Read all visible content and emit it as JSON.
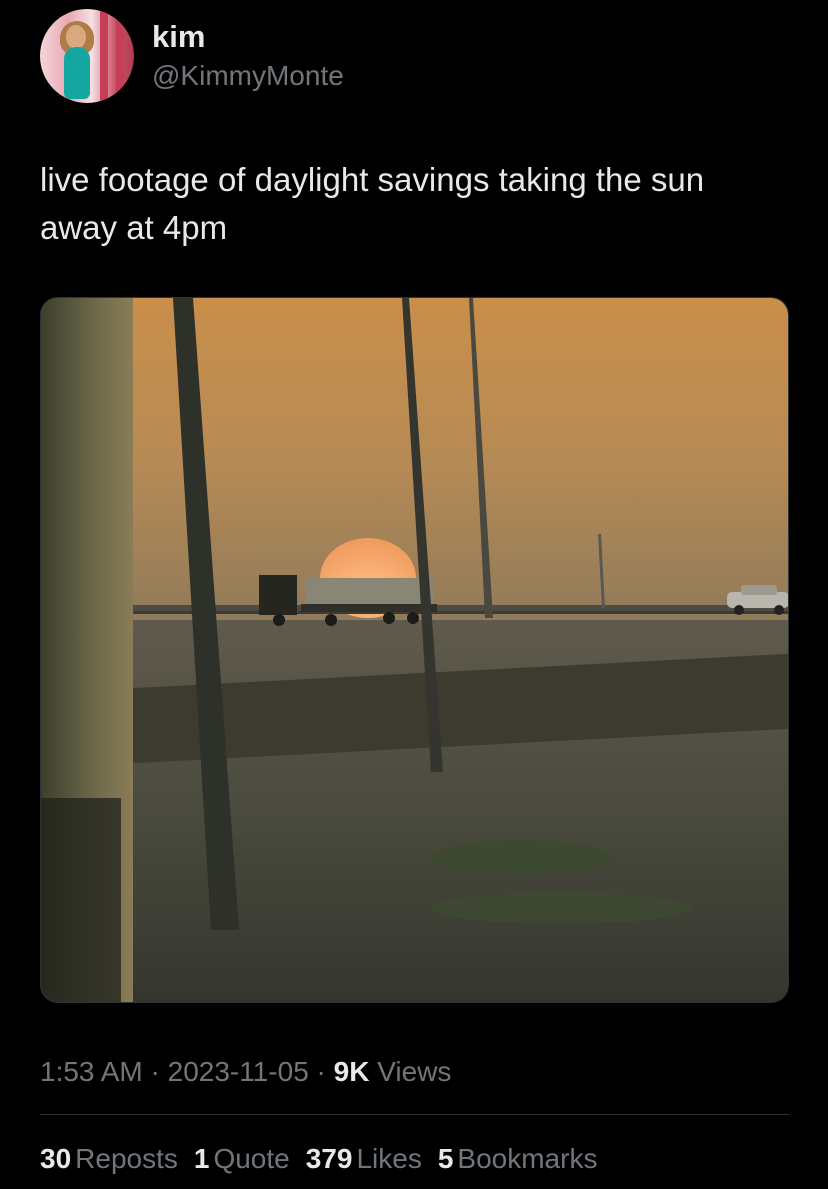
{
  "author": {
    "display_name": "kim",
    "handle": "@KimmyMonte"
  },
  "tweet": {
    "text": "live footage of daylight savings taking the sun away at 4pm",
    "media_description_icon": "photo-sunset-truck"
  },
  "meta": {
    "time": "1:53 AM",
    "separator1": " · ",
    "date": "2023-11-05",
    "separator2": " · ",
    "views_count": "9K",
    "views_label": " Views"
  },
  "stats": {
    "reposts_count": "30",
    "reposts_label": "Reposts",
    "quotes_count": "1",
    "quotes_label": "Quote",
    "likes_count": "379",
    "likes_label": "Likes",
    "bookmarks_count": "5",
    "bookmarks_label": "Bookmarks"
  },
  "colors": {
    "background": "#000000",
    "primary_text": "#e7e9ea",
    "secondary_text": "#71767b",
    "divider": "#2f3336"
  }
}
